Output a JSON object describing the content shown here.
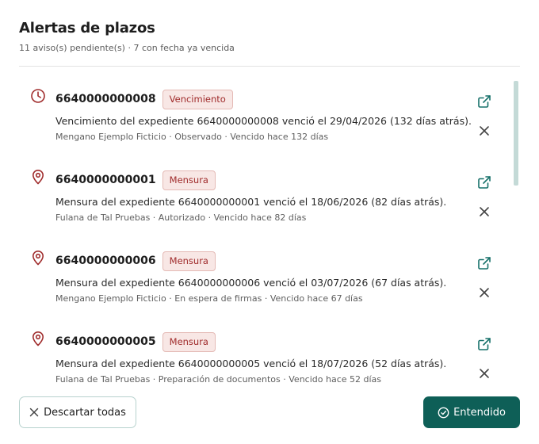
{
  "header": {
    "title": "Alertas de plazos",
    "subtitle": "11 aviso(s) pendiente(s) · 7 con fecha ya vencida"
  },
  "colors": {
    "accent": "#0e5f57",
    "icon_alert": "#a02c2c",
    "badge_text": "#a02c2c",
    "badge_bg": "#f8e7e5",
    "action_icon": "#17716a"
  },
  "alerts": [
    {
      "icon": "clock-icon",
      "id": "6640000000008",
      "badge": "Vencimiento",
      "description": "Vencimiento del expediente 6640000000008 venció el 29/04/2026 (132 días atrás).",
      "meta": "Mengano Ejemplo Ficticio · Observado · Vencido hace 132 días"
    },
    {
      "icon": "location-pin-icon",
      "id": "6640000000001",
      "badge": "Mensura",
      "description": "Mensura del expediente 6640000000001 venció el 18/06/2026 (82 días atrás).",
      "meta": "Fulana de Tal Pruebas · Autorizado · Vencido hace 82 días"
    },
    {
      "icon": "location-pin-icon",
      "id": "6640000000006",
      "badge": "Mensura",
      "description": "Mensura del expediente 6640000000006 venció el 03/07/2026 (67 días atrás).",
      "meta": "Mengano Ejemplo Ficticio · En espera de firmas · Vencido hace 67 días"
    },
    {
      "icon": "location-pin-icon",
      "id": "6640000000005",
      "badge": "Mensura",
      "description": "Mensura del expediente 6640000000005 venció el 18/07/2026 (52 días atrás).",
      "meta": "Fulana de Tal Pruebas · Preparación de documentos · Vencido hace 52 días"
    }
  ],
  "footer": {
    "discard_label": "Descartar todas",
    "ok_label": "Entendido"
  }
}
